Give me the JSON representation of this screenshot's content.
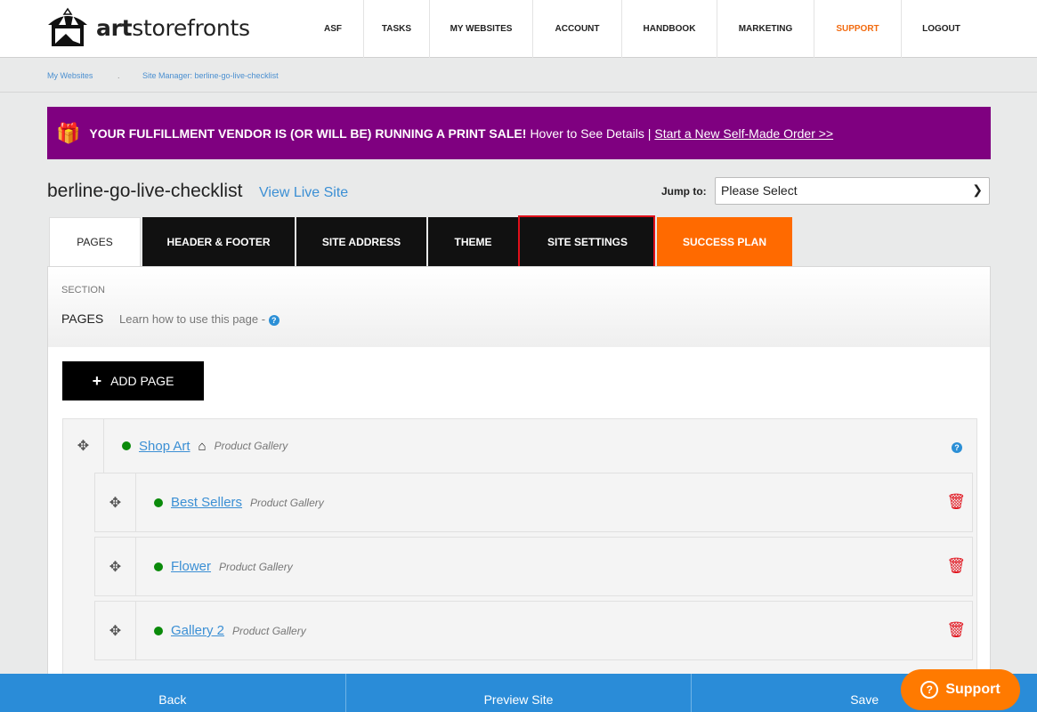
{
  "header": {
    "logo_bold": "art",
    "logo_rest": "storefronts",
    "nav": [
      {
        "label": "ASF",
        "w": 68
      },
      {
        "label": "TASKS",
        "w": 74
      },
      {
        "label": "MY WEBSITES",
        "w": 116
      },
      {
        "label": "ACCOUNT",
        "w": 100
      },
      {
        "label": "HANDBOOK",
        "w": 107
      },
      {
        "label": "MARKETING",
        "w": 109
      },
      {
        "label": "SUPPORT",
        "w": 98,
        "active": true
      },
      {
        "label": "LOGOUT",
        "w": 90
      }
    ]
  },
  "breadcrumb": {
    "item1": "My Websites",
    "sep": ".",
    "item2": "Site Manager: berline-go-live-checklist"
  },
  "promo": {
    "bold": "YOUR FULFILLMENT VENDOR IS (OR WILL BE) RUNNING A PRINT SALE!",
    "text": "Hover to See Details |",
    "link": "Start a New Self-Made Order >>"
  },
  "site": {
    "title": "berline-go-live-checklist",
    "view_live": "View Live Site",
    "jump_label": "Jump to:",
    "jump_value": "Please Select"
  },
  "tabs": [
    {
      "label": "PAGES",
      "w": 103,
      "cls": "active"
    },
    {
      "label": "HEADER & FOOTER",
      "w": 171
    },
    {
      "label": "SITE ADDRESS",
      "w": 146
    },
    {
      "label": "THEME",
      "w": 101
    },
    {
      "label": "SITE SETTINGS",
      "w": 152
    },
    {
      "label": "SUCCESS PLAN",
      "w": 152,
      "cls": "orange"
    }
  ],
  "section": {
    "label": "SECTION",
    "name": "PAGES",
    "learn": "Learn how to use this page -"
  },
  "add_page": "ADD PAGE",
  "pages": [
    {
      "name": "Shop Art",
      "type": "Product Gallery",
      "home": true
    },
    {
      "name": "Best Sellers",
      "type": "Product Gallery"
    },
    {
      "name": "Flower",
      "type": "Product Gallery"
    },
    {
      "name": "Gallery 2",
      "type": "Product Gallery"
    }
  ],
  "footer": {
    "back": "Back",
    "preview": "Preview Site",
    "save": "Save"
  },
  "support_button": "Support",
  "colors": {
    "promo": "#7f0080",
    "accent": "#ff6a00",
    "footer": "#2a8cd8",
    "highlight": "#e0101a"
  }
}
